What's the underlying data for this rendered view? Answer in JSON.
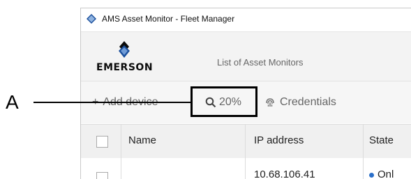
{
  "window": {
    "title": "AMS Asset Monitor - Fleet Manager"
  },
  "header": {
    "logo_text": "EMERSON",
    "page_title": "List of Asset Monitors"
  },
  "toolbar": {
    "add_plus": "+",
    "add_label": "Add device",
    "search_zoom": "20%",
    "credentials_label": "Credentials"
  },
  "table": {
    "columns": [
      "Name",
      "IP address",
      "State"
    ],
    "rows": [
      {
        "name": "",
        "ip": "10.68.106.41",
        "state": "Onl"
      }
    ]
  },
  "callout": {
    "label": "A"
  },
  "colors": {
    "accent": "#2a6fc9",
    "header_bg": "#f3f3f3",
    "toolbar_bg": "#f6f6f6"
  }
}
